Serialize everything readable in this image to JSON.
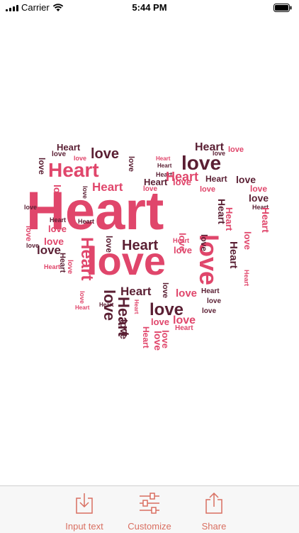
{
  "status_bar": {
    "carrier": "Carrier",
    "time": "5:44 PM",
    "icons": [
      "signal-icon",
      "wifi-icon",
      "battery-icon"
    ]
  },
  "cloud": {
    "colors": {
      "pink": "#e0466b",
      "dark": "#5a1f33"
    },
    "words": [
      "Heart",
      "love",
      "love",
      "love",
      "Heart",
      "love",
      "Heart",
      "love",
      "Heart",
      "Heart",
      "Heart",
      "love",
      "love",
      "love",
      "Heart",
      "love",
      "Heart",
      "Heart",
      "love",
      "Heart",
      "love",
      "love",
      "love",
      "love",
      "Heart",
      "love",
      "love",
      "Heart",
      "Heart",
      "Heart",
      "love",
      "love",
      "love",
      "Heart",
      "Heart",
      "love",
      "love",
      "love",
      "Heart",
      "Heart",
      "love",
      "Heart",
      "love",
      "love",
      "love",
      "Heart",
      "love",
      "Heart",
      "Heart",
      "love",
      "Heart",
      "love",
      "love",
      "Heart",
      "Heart",
      "love",
      "love",
      "Heart",
      "love",
      "love",
      "love",
      "love",
      "love",
      "Heart",
      "Heart",
      "love",
      "Heart",
      "love",
      "Heart",
      "love",
      "love",
      "Heart",
      "love",
      "Heart"
    ]
  },
  "toolbar": {
    "accent": "#d96f61",
    "input_text_label": "Input text",
    "customize_label": "Customize",
    "share_label": "Share"
  }
}
